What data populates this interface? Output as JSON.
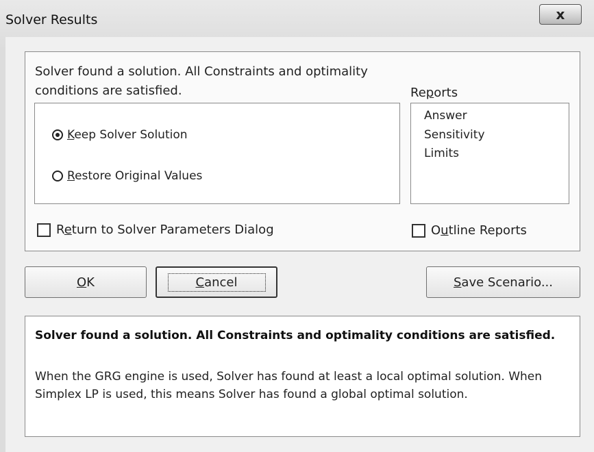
{
  "window": {
    "title": "Solver Results",
    "close_symbol": "x"
  },
  "status": {
    "line1": "Solver found a solution.  All Constraints and optimality",
    "line2": "conditions are satisfied."
  },
  "options": {
    "keep": {
      "label_prefix": "",
      "access_key": "K",
      "label_rest": "eep Solver Solution",
      "selected": true
    },
    "restore": {
      "label_prefix": "",
      "access_key": "R",
      "label_rest": "estore Original Values",
      "selected": false
    }
  },
  "reports": {
    "label_prefix": "Re",
    "access_key": "p",
    "label_rest": "orts",
    "items": [
      "Answer",
      "Sensitivity",
      "Limits"
    ]
  },
  "return_check": {
    "label_prefix": "R",
    "access_key": "e",
    "label_rest": "turn to Solver Parameters Dialog",
    "checked": false
  },
  "outline_check": {
    "label_prefix": "O",
    "access_key": "u",
    "label_rest": "tline Reports",
    "checked": false
  },
  "buttons": {
    "ok": {
      "access_key": "O",
      "label_rest": "K"
    },
    "cancel": {
      "access_key": "C",
      "label_rest": "ancel"
    },
    "save": {
      "access_key": "S",
      "label_rest": "ave Scenario..."
    }
  },
  "info": {
    "bold_text": "Solver found a solution.  All Constraints and optimality conditions are satisfied.",
    "body_text": "When the GRG engine is used, Solver has found at least a local optimal solution. When Simplex LP is used, this means Solver has found a global optimal solution."
  }
}
